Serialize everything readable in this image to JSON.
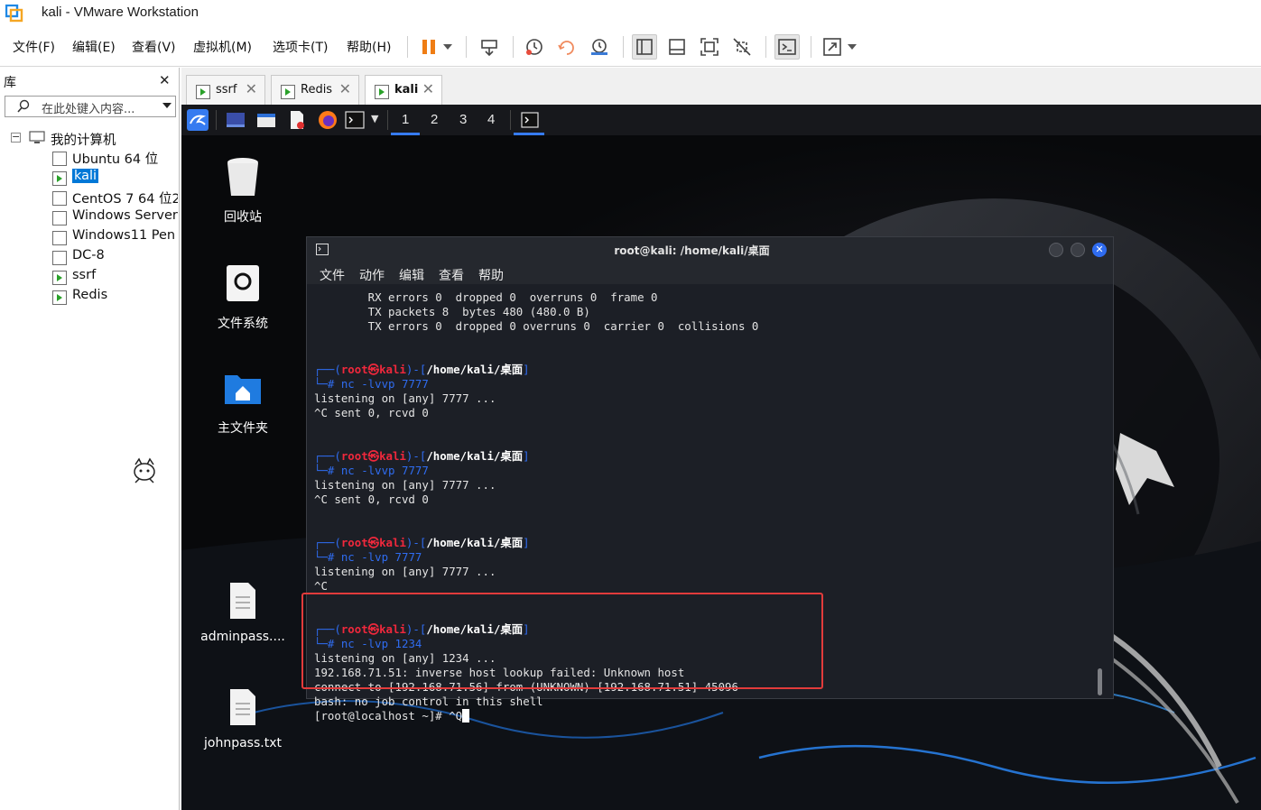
{
  "window": {
    "title": "kali - VMware Workstation"
  },
  "menu": {
    "items": [
      "文件(F)",
      "编辑(E)",
      "查看(V)",
      "虚拟机(M)",
      "选项卡(T)",
      "帮助(H)"
    ]
  },
  "library": {
    "header": "库",
    "close": "✕",
    "search_placeholder": "在此处键入内容...",
    "root": "我的计算机",
    "items": [
      {
        "label": "Ubuntu 64 位",
        "running": false,
        "selected": false
      },
      {
        "label": "kali",
        "running": true,
        "selected": true
      },
      {
        "label": "CentOS 7 64 位2",
        "running": false,
        "selected": false
      },
      {
        "label": "Windows Server",
        "running": false,
        "selected": false
      },
      {
        "label": "Windows11 Pen",
        "running": false,
        "selected": false
      },
      {
        "label": "DC-8",
        "running": false,
        "selected": false
      },
      {
        "label": "ssrf",
        "running": true,
        "selected": false
      },
      {
        "label": "Redis",
        "running": true,
        "selected": false
      }
    ]
  },
  "tabs": [
    {
      "label": "ssrf",
      "active": false
    },
    {
      "label": "Redis",
      "active": false
    },
    {
      "label": "kali",
      "active": true
    }
  ],
  "kali_panel": {
    "workspaces": [
      "1",
      "2",
      "3",
      "4"
    ],
    "active_workspace": "1"
  },
  "desktop": {
    "icons": [
      "回收站",
      "文件系统",
      "主文件夹",
      "adminpass....",
      "johnpass.txt"
    ]
  },
  "terminal": {
    "title": "root@kali: /home/kali/桌面",
    "menu": [
      "文件",
      "动作",
      "编辑",
      "查看",
      "帮助"
    ],
    "prompt": {
      "open": "┌──(",
      "user": "root㉿kali",
      "close": ")-[",
      "path": "/home/kali/桌面",
      "end": "]",
      "hash": "└─#"
    },
    "pre_lines": [
      "        RX errors 0  dropped 0  overruns 0  frame 0",
      "        TX packets 8  bytes 480 (480.0 B)",
      "        TX errors 0  dropped 0 overruns 0  carrier 0  collisions 0"
    ],
    "sessions": [
      {
        "cmd": "nc -lvvp 7777",
        "output": [
          "listening on [any] 7777 ...",
          "^C sent 0, rcvd 0"
        ]
      },
      {
        "cmd": "nc -lvvp 7777",
        "output": [
          "listening on [any] 7777 ...",
          "^C sent 0, rcvd 0"
        ]
      },
      {
        "cmd": "nc -lvp 7777",
        "output": [
          "listening on [any] 7777 ...",
          "^C"
        ]
      },
      {
        "cmd": "nc -lvp 1234",
        "output": [
          "listening on [any] 1234 ...",
          "192.168.71.51: inverse host lookup failed: Unknown host",
          "connect to [192.168.71.56] from (UNKNOWN) [192.168.71.51] 45096",
          "bash: no job control in this shell",
          "[root@localhost ~]# ^Q"
        ]
      }
    ]
  },
  "colors": {
    "kali_blue": "#2f6cf0",
    "kali_red": "#f0283c",
    "highlight": "#e23b3b",
    "vm_running": "#2aa12a"
  }
}
